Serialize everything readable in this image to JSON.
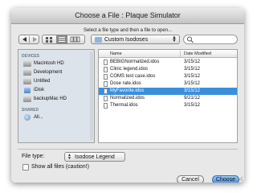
{
  "window": {
    "title": "Choose a File : Plaque Simulator",
    "prompt": "Select a file type and then a file to open..."
  },
  "toolbar": {
    "back_icon": "back-arrow-icon",
    "forward_icon": "forward-arrow-icon",
    "folder_popup": "Custom Isodoses",
    "search_placeholder": ""
  },
  "sidebar": {
    "sections": [
      {
        "heading": "DEVICES",
        "items": [
          {
            "label": "Macintosh HD",
            "icon": "hard-drive-icon"
          },
          {
            "label": "Development",
            "icon": "hard-drive-icon"
          },
          {
            "label": "Untitled",
            "icon": "hard-drive-icon"
          },
          {
            "label": "iDisk",
            "icon": "idisk-icon"
          },
          {
            "label": "backupMac HD",
            "icon": "hard-drive-icon"
          }
        ]
      },
      {
        "heading": "SHARED",
        "items": [
          {
            "label": "All...",
            "icon": "network-globe-icon"
          }
        ]
      }
    ]
  },
  "filelist": {
    "columns": [
      "Name",
      "Date Modified"
    ],
    "rows": [
      {
        "name": "BEBIGNormalized.idos",
        "date": "3/15/12",
        "selected": false
      },
      {
        "name": "Clinic legend.idos",
        "date": "3/15/12",
        "selected": false
      },
      {
        "name": "COMS test case.idos",
        "date": "3/15/12",
        "selected": false
      },
      {
        "name": "Dose rate.idos",
        "date": "3/15/12",
        "selected": false
      },
      {
        "name": "MyFavorite.idos",
        "date": "3/15/12",
        "selected": true
      },
      {
        "name": "Normalized.idos",
        "date": "9/21/12",
        "selected": false
      },
      {
        "name": "Thermal.idos",
        "date": "3/15/12",
        "selected": false
      }
    ]
  },
  "bottom": {
    "file_type_label": "File type:",
    "file_type_value": "Isodose Legend",
    "show_all_label": "Show all files (caution!)",
    "show_all_checked": false
  },
  "buttons": {
    "cancel": "Cancel",
    "choose": "Choose"
  },
  "colors": {
    "selection": "#3b8edb",
    "sidebar_bg": "#dde3ea",
    "default_button": "#3f8fe0"
  }
}
